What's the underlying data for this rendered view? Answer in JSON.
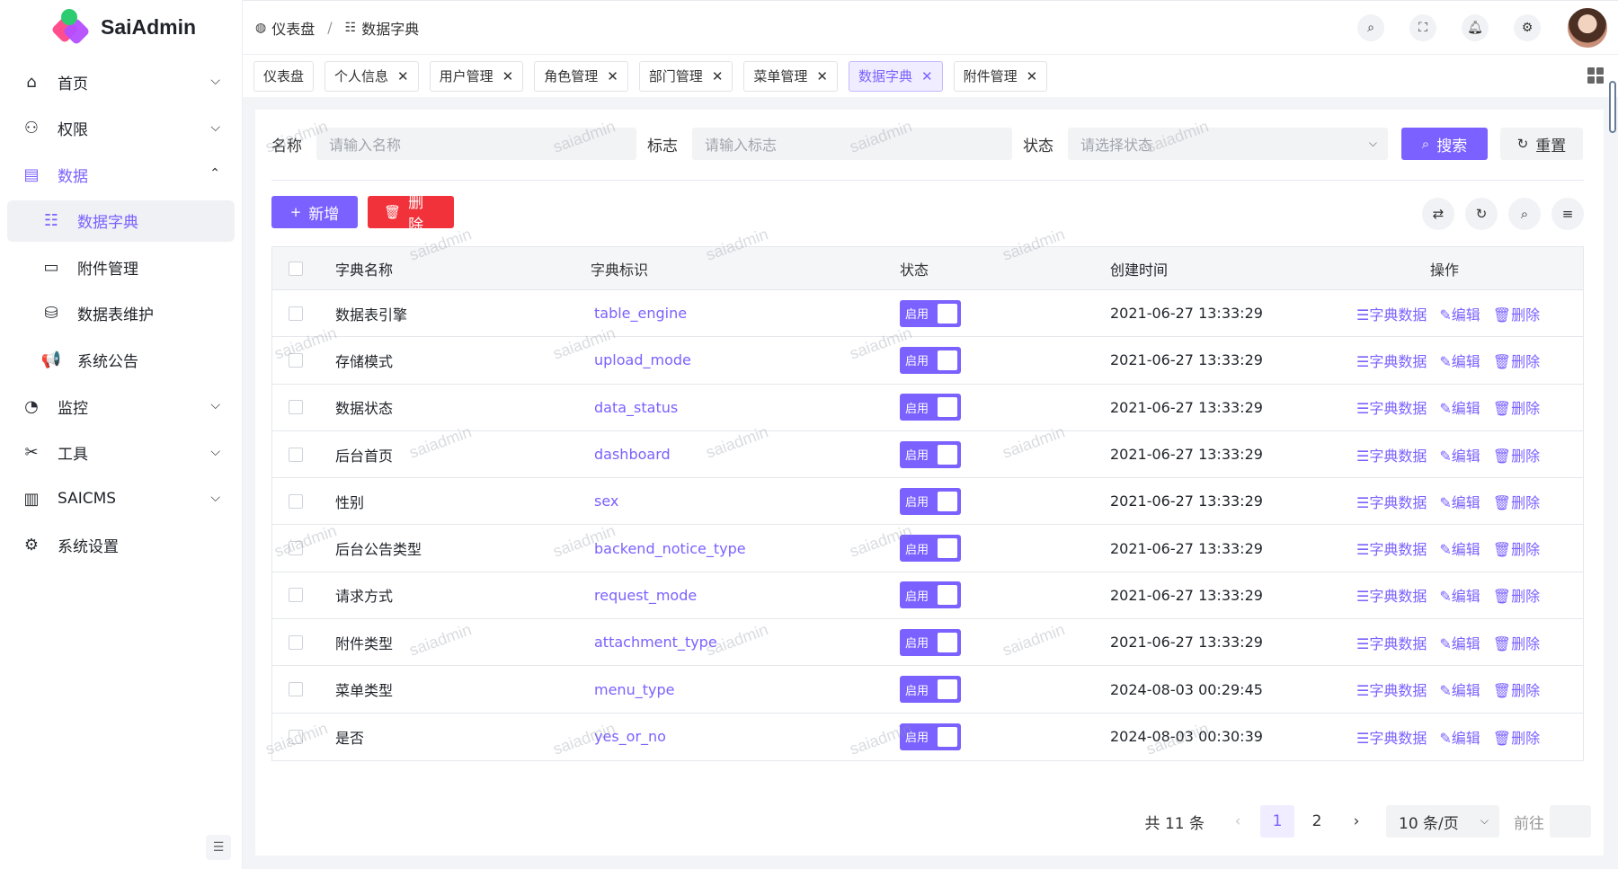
{
  "app": {
    "name": "SaiAdmin"
  },
  "sidebar": {
    "items": [
      {
        "label": "首页",
        "icon": "home-icon"
      },
      {
        "label": "权限",
        "icon": "user-lock-icon"
      },
      {
        "label": "数据",
        "icon": "database-list-icon"
      },
      {
        "label": "数据字典",
        "icon": "dictionary-icon"
      },
      {
        "label": "附件管理",
        "icon": "attachment-icon"
      },
      {
        "label": "数据表维护",
        "icon": "table-maintain-icon"
      },
      {
        "label": "系统公告",
        "icon": "megaphone-icon"
      },
      {
        "label": "监控",
        "icon": "monitor-icon"
      },
      {
        "label": "工具",
        "icon": "tools-icon"
      },
      {
        "label": "SAICMS",
        "icon": "book-icon"
      },
      {
        "label": "系统设置",
        "icon": "gear-icon"
      }
    ]
  },
  "header": {
    "breadcrumb": [
      "仪表盘",
      "数据字典"
    ]
  },
  "tabs": [
    {
      "label": "仪表盘"
    },
    {
      "label": "个人信息"
    },
    {
      "label": "用户管理"
    },
    {
      "label": "角色管理"
    },
    {
      "label": "部门管理"
    },
    {
      "label": "菜单管理"
    },
    {
      "label": "数据字典"
    },
    {
      "label": "附件管理"
    }
  ],
  "filter": {
    "name_label": "名称",
    "name_placeholder": "请输入名称",
    "code_label": "标志",
    "code_placeholder": "请输入标志",
    "status_label": "状态",
    "status_placeholder": "请选择状态",
    "search_label": "搜索",
    "reset_label": "重置"
  },
  "toolbar": {
    "add_label": "新增",
    "delete_label": "删除"
  },
  "table": {
    "columns": [
      "字典名称",
      "字典标识",
      "状态",
      "创建时间",
      "操作"
    ],
    "rows": [
      {
        "name": "数据表引擎",
        "code": "table_engine",
        "status": "启用",
        "time": "2021-06-27 13:33:29"
      },
      {
        "name": "存储模式",
        "code": "upload_mode",
        "status": "启用",
        "time": "2021-06-27 13:33:29"
      },
      {
        "name": "数据状态",
        "code": "data_status",
        "status": "启用",
        "time": "2021-06-27 13:33:29"
      },
      {
        "name": "后台首页",
        "code": "dashboard",
        "status": "启用",
        "time": "2021-06-27 13:33:29"
      },
      {
        "name": "性别",
        "code": "sex",
        "status": "启用",
        "time": "2021-06-27 13:33:29"
      },
      {
        "name": "后台公告类型",
        "code": "backend_notice_type",
        "status": "启用",
        "time": "2021-06-27 13:33:29"
      },
      {
        "name": "请求方式",
        "code": "request_mode",
        "status": "启用",
        "time": "2021-06-27 13:33:29"
      },
      {
        "name": "附件类型",
        "code": "attachment_type",
        "status": "启用",
        "time": "2021-06-27 13:33:29"
      },
      {
        "name": "菜单类型",
        "code": "menu_type",
        "status": "启用",
        "time": "2024-08-03 00:29:45"
      },
      {
        "name": "是否",
        "code": "yes_or_no",
        "status": "启用",
        "time": "2024-08-03 00:30:39"
      }
    ],
    "ops": [
      "☰字典数据",
      "✎编辑",
      "🗑删除"
    ]
  },
  "pager": {
    "total": "共 11 条",
    "pages": [
      "1",
      "2"
    ],
    "page_size": "10 条/页",
    "goto_label": "前往"
  },
  "watermark": "saiadmin",
  "colors": {
    "primary": "#7b61ff",
    "danger": "#f2323a"
  }
}
